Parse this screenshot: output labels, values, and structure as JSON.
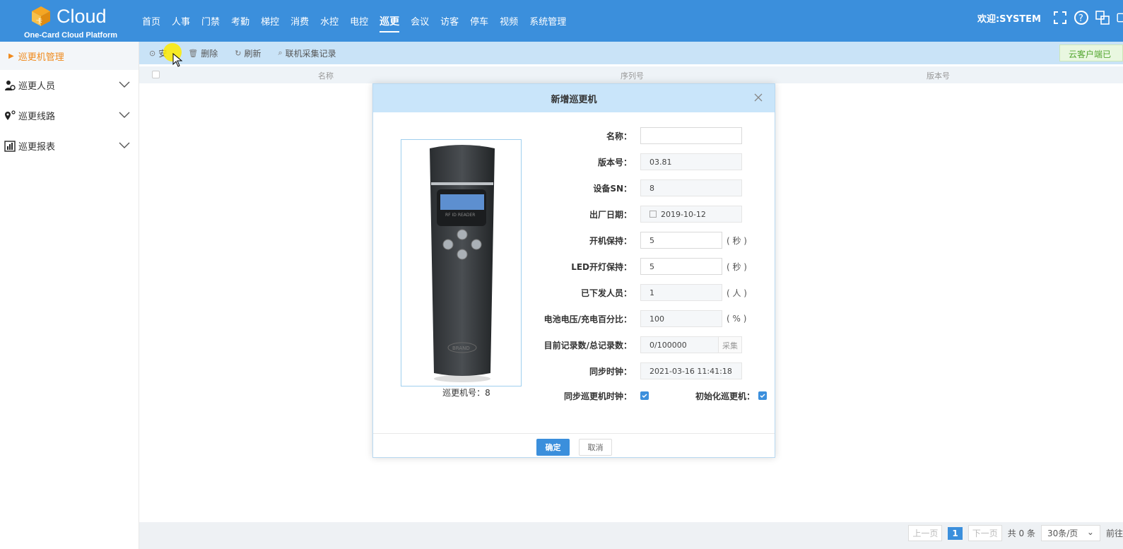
{
  "app": {
    "logo_text": "Cloud",
    "logo_mark": "卡",
    "logo_subtitle": "One-Card Cloud Platform"
  },
  "nav": {
    "items": [
      "首页",
      "人事",
      "门禁",
      "考勤",
      "梯控",
      "消费",
      "水控",
      "电控",
      "巡更",
      "会议",
      "访客",
      "停车",
      "视频",
      "系统管理"
    ],
    "active_index": 8
  },
  "header": {
    "welcome": "欢迎:SYSTEM",
    "icons": [
      "fullscreen-icon",
      "help-icon",
      "language-icon"
    ]
  },
  "sidebar": {
    "head_label": "巡更机管理",
    "items": [
      {
        "label": "巡更人员",
        "icon": "person-icon"
      },
      {
        "label": "巡更线路",
        "icon": "route-icon"
      },
      {
        "label": "巡更报表",
        "icon": "report-icon"
      }
    ]
  },
  "toolbar": {
    "add_label": "安",
    "delete_label": "删除",
    "refresh_label": "刷新",
    "collect_label": "联机采集记录",
    "right_badge": "云客户端已"
  },
  "table": {
    "columns": [
      "名称",
      "序列号",
      "版本号"
    ]
  },
  "dialog": {
    "title": "新增巡更机",
    "device_caption": "巡更机号：8",
    "device_screen_text": "RF ID READER",
    "device_brand": "BRAND",
    "fields": {
      "name": {
        "label": "名称：",
        "value": ""
      },
      "version": {
        "label": "版本号：",
        "value": "03.81"
      },
      "sn": {
        "label": "设备SN：",
        "value": "8"
      },
      "date": {
        "label": "出厂日期：",
        "value": "2019-10-12"
      },
      "boot_hold": {
        "label": "开机保持：",
        "value": "5",
        "unit": "( 秒 )"
      },
      "led_hold": {
        "label": "LED开灯保持：",
        "value": "5",
        "unit": "( 秒 )"
      },
      "issued": {
        "label": "已下发人员：",
        "value": "1",
        "unit": "( 人 )"
      },
      "battery": {
        "label": "电池电压/充电百分比：",
        "value": "100",
        "unit": "( % )"
      },
      "records": {
        "label": "目前记录数/总记录数：",
        "value": "0/100000",
        "action": "采集"
      },
      "clock": {
        "label": "同步时钟：",
        "value": "2021-03-16 11:41:18"
      }
    },
    "sync_clock_label": "同步巡更机时钟：",
    "sync_clock_checked": true,
    "init_label": "初始化巡更机：",
    "init_checked": true,
    "ok_label": "确定",
    "cancel_label": "取消"
  },
  "pager": {
    "prev": "上一页",
    "current": "1",
    "next": "下一页",
    "total": "共 0 条",
    "page_size": "30条/页",
    "goto": "前往"
  },
  "colors": {
    "primary": "#3b8fdc",
    "accent_orange": "#f08a1c",
    "dialog_header": "#c9e5fa"
  }
}
